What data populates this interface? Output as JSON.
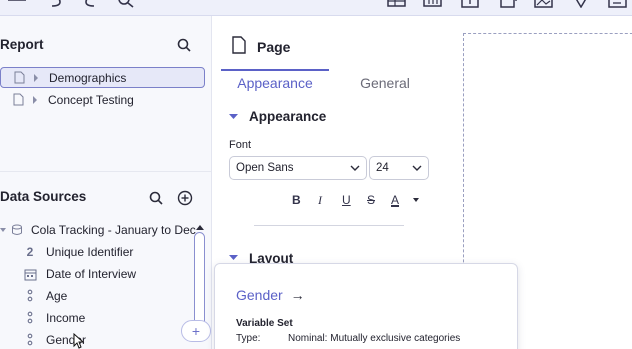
{
  "report": {
    "title": "Report",
    "items": [
      {
        "label": "Demographics",
        "selected": true
      },
      {
        "label": "Concept Testing",
        "selected": false
      }
    ]
  },
  "data_sources": {
    "title": "Data Sources",
    "dataset": "Cola Tracking - January to Dec",
    "variables": [
      {
        "label": "Unique Identifier",
        "icon": "numeric-2-icon",
        "glyph": "2"
      },
      {
        "label": "Date of Interview",
        "icon": "calendar-icon",
        "glyph": ""
      },
      {
        "label": "Age",
        "icon": "nominal-variable-icon",
        "glyph": ""
      },
      {
        "label": "Income",
        "icon": "nominal-variable-icon",
        "glyph": ""
      },
      {
        "label": "Gender",
        "icon": "nominal-variable-icon",
        "glyph": ""
      }
    ]
  },
  "page_panel": {
    "title": "Page",
    "tabs": [
      {
        "label": "Appearance",
        "active": true
      },
      {
        "label": "General",
        "active": false
      }
    ],
    "appearance_section": "Appearance",
    "font_label": "Font",
    "font_family": "Open Sans",
    "font_size": "24",
    "format_buttons": [
      "B",
      "I",
      "U",
      "S",
      "A"
    ],
    "layout_section": "Layout"
  },
  "tooltip": {
    "variable_name": "Gender",
    "arrow": "→",
    "set_label": "Variable Set",
    "type_key": "Type:",
    "type_value": "Nominal: Mutually exclusive categories"
  },
  "colors": {
    "accent": "#5b61c7",
    "panel_bg": "#f7f8fc",
    "selected_bg": "#e6e8f8",
    "toolbar_bg": "#eef0fa"
  }
}
